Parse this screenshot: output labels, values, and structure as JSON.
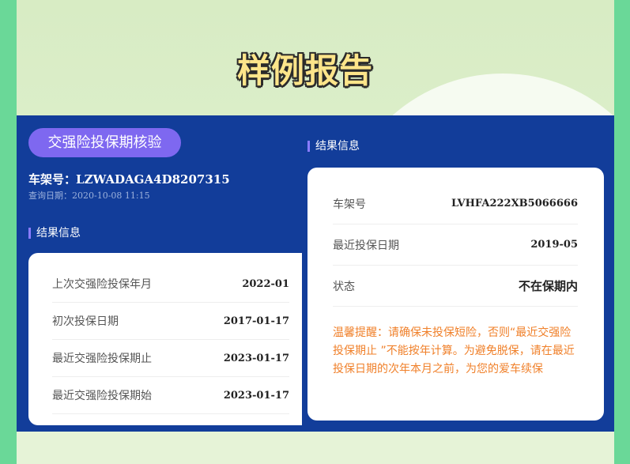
{
  "header": {
    "title": "样例报告"
  },
  "query": {
    "badge": "交强险投保期核验",
    "vin_label": "车架号：",
    "vin": "LZWADAGA4D8207315",
    "date_label": "查询日期：",
    "date": "2020-10-08 11:15"
  },
  "left_section": {
    "heading": "结果信息",
    "rows": [
      {
        "label": "上次交强险投保年月",
        "value": "2022-01"
      },
      {
        "label": "初次投保日期",
        "value": "2017-01-17"
      },
      {
        "label": "最近交强险投保期止",
        "value": "2023-01-17"
      },
      {
        "label": "最近交强险投保期始",
        "value": "2023-01-17"
      }
    ]
  },
  "right_section": {
    "heading": "结果信息",
    "rows": [
      {
        "label": "车架号",
        "value": "LVHFA222XB5066666"
      },
      {
        "label": "最近投保日期",
        "value": "2019-05"
      },
      {
        "label": "状态",
        "value": "不在保期内"
      }
    ],
    "tip": "温馨提醒：请确保未投保短险，否则“最近交强险投保期止 ”不能按年计算。为避免脱保，请在最近投保日期的次年本月之前，为您的爱车续保"
  },
  "colors": {
    "panel": "#123d9a",
    "accent": "#7e68f0",
    "tip": "#f0802a",
    "outer": "#6ad898"
  }
}
